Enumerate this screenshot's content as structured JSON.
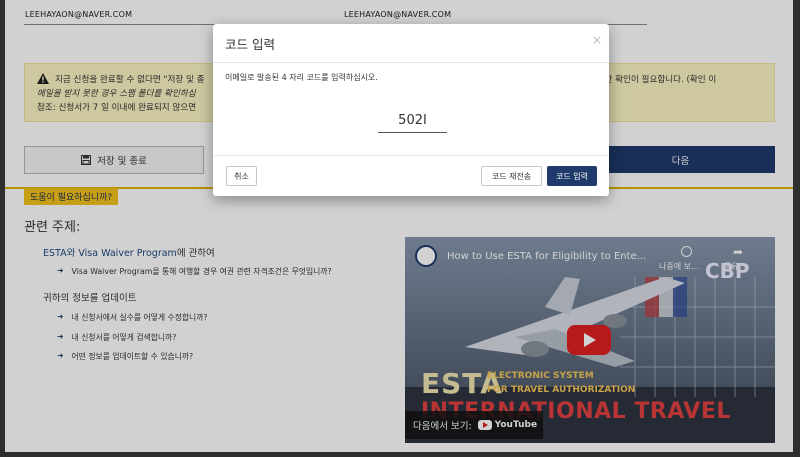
{
  "emails": [
    "LEEHAYAON@NAVER.COM",
    "LEEHAYAON@NAVER.COM"
  ],
  "warning": {
    "line1_left": "지금 신청을 완료할 수 없다면 \"저장 및 종",
    "line1_right": "스에 대한 확인이 필요합니다. (확인 이",
    "line2_left": "메일을 받지 못한 경우 스팸 폴더를 확인하십",
    "line3_left": "참조: 신청서가 7 일 이내에 완료되지 않으면"
  },
  "actions": {
    "save_label": "저장 및 종료",
    "next_label": "다음"
  },
  "help_badge": "도움이 필요하십니까?",
  "related": {
    "title": "관련 주제:",
    "topic1_link": "ESTA와 Visa Waiver Program",
    "topic1_tail": "에 관하여",
    "topic1_items": [
      "Visa Waiver Program을 통해 여행할 경우 여권 관련 자격조건은 무엇입니까?"
    ],
    "topic2_head": "귀하의 정보를 업데이트",
    "topic2_items": [
      "내 신청서에서 실수를 어떻게 수정합니까?",
      "내 신청서를 어떻게 검색합니까?",
      "어떤 정보를 업데이트할 수 있습니까?"
    ]
  },
  "video": {
    "title": "How to Use ESTA for Eligibility to Ente...",
    "clock_label": "나중에 보...",
    "share_label": "공유",
    "cbp": "CBP",
    "esta": "ESTA",
    "sub1": "ELECTRONIC SYSTEM",
    "sub2": "FOR TRAVEL AUTHORIZATION",
    "intl": "INTERNATIONAL TRAVEL",
    "watch_on": "다음에서 보기:",
    "youtube": "YouTube"
  },
  "modal": {
    "title": "코드 입력",
    "close": "×",
    "instruction": "이메일로 발송된 4 자리 코드를 입력하십시오.",
    "code_value": "502I",
    "cancel_label": "취소",
    "resend_label": "코드 재전송",
    "submit_label": "코드 입력"
  },
  "colors": {
    "primary": "#1f3a6b",
    "warning_bg": "#fbf5c4",
    "help_badge": "#f2c31c",
    "divider": "#e0b400"
  }
}
